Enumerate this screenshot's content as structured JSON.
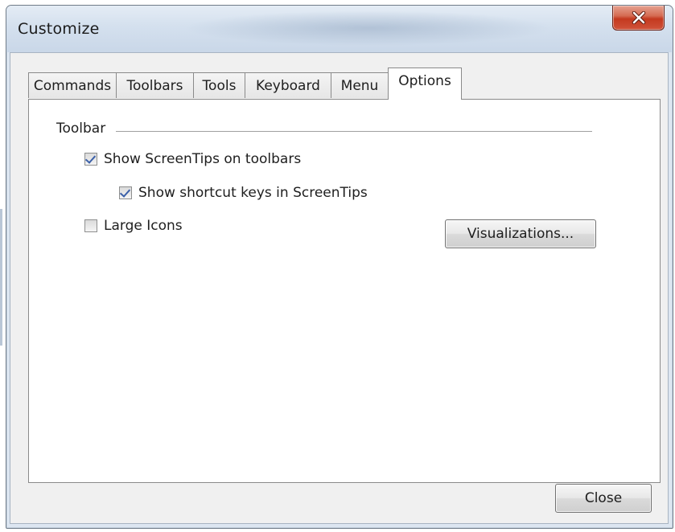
{
  "window": {
    "title": "Customize",
    "close_icon": "close-x-icon"
  },
  "tabs": [
    {
      "label": "Commands",
      "active": false
    },
    {
      "label": "Toolbars",
      "active": false
    },
    {
      "label": "Tools",
      "active": false
    },
    {
      "label": "Keyboard",
      "active": false
    },
    {
      "label": "Menu",
      "active": false
    },
    {
      "label": "Options",
      "active": true
    }
  ],
  "options": {
    "group_label": "Toolbar",
    "show_screentips": {
      "label": "Show ScreenTips on toolbars",
      "checked": true
    },
    "show_shortcut_keys": {
      "label": "Show shortcut keys in ScreenTips",
      "checked": true
    },
    "large_icons": {
      "label": "Large Icons",
      "checked": false
    },
    "visualizations_label": "Visualizations..."
  },
  "footer": {
    "close_label": "Close"
  },
  "colors": {
    "close_button": "#c4391f",
    "frame": "#dde6f1",
    "check": "#3a5fa8"
  }
}
